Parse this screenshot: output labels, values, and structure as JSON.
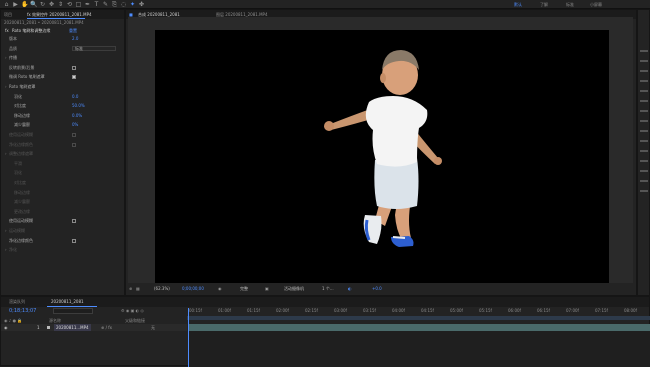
{
  "toolbar": {
    "tools": [
      "home-icon",
      "selection-icon",
      "hand-icon",
      "zoom-icon",
      "orbit-icon",
      "pan-icon",
      "dolly-icon",
      "rotate-icon",
      "rect-mask-icon",
      "pen-icon",
      "type-icon",
      "brush-icon",
      "clone-icon",
      "eraser-icon",
      "roto-brush-icon",
      "puppet-icon"
    ],
    "workspaces": [
      "默认",
      "了解",
      "标准",
      "小屏幕"
    ]
  },
  "project_tab": "项目",
  "effect_tab": "fx 效果控件 20200811_2081.MP4",
  "effect_subtitle": "20200811_2081 • 20200811_2081.MP4",
  "comp_tabs": {
    "comp": "合成 20200811_2081",
    "footage": "图层 20200811_2081.MP4"
  },
  "comp_subtab": "20200811_2081",
  "effect": {
    "name": "Roto 笔刷和调整边缘",
    "reset": "重置",
    "props": [
      {
        "label": "版本",
        "value": "2.0",
        "style": "blue"
      },
      {
        "label": "品质",
        "value": "标准",
        "type": "dropdown"
      },
      {
        "label": "传播",
        "value": "",
        "type": "section"
      },
      {
        "label": "反转前景/后景",
        "type": "checkbox",
        "checked": false
      },
      {
        "label": "微调 Roto 笔刷遮罩",
        "type": "checkbox",
        "checked": true
      },
      {
        "label": "Roto 笔刷遮罩",
        "value": "",
        "type": "section"
      },
      {
        "label": "羽化",
        "value": "0.0",
        "style": "blue",
        "indent": 2
      },
      {
        "label": "对比度",
        "value": "50.0%",
        "style": "blue",
        "indent": 2
      },
      {
        "label": "移动边缘",
        "value": "0.0%",
        "style": "blue",
        "indent": 2
      },
      {
        "label": "减少震颤",
        "value": "0%",
        "style": "blue",
        "indent": 2
      },
      {
        "label": "使用运动模糊",
        "type": "checkbox",
        "dim": true
      },
      {
        "label": "净化边缘颜色",
        "type": "checkbox",
        "dim": true
      },
      {
        "label": "调整边缘遮罩",
        "type": "section",
        "dim": true
      },
      {
        "label": "平滑",
        "value": "",
        "dim": true,
        "indent": 2
      },
      {
        "label": "羽化",
        "value": "",
        "dim": true,
        "indent": 2
      },
      {
        "label": "对比度",
        "value": "",
        "dim": true,
        "indent": 2
      },
      {
        "label": "移动边缘",
        "value": "",
        "dim": true,
        "indent": 2
      },
      {
        "label": "减少震颤",
        "value": "",
        "dim": true,
        "indent": 2
      },
      {
        "label": "更改边缘",
        "value": "",
        "dim": true,
        "indent": 2
      },
      {
        "label": "使用运动模糊",
        "type": "checkbox",
        "checked": false
      },
      {
        "label": "运动模糊",
        "type": "section",
        "dim": true
      },
      {
        "label": "净化边缘颜色",
        "type": "checkbox",
        "checked": false
      },
      {
        "label": "净化",
        "type": "section",
        "dim": true
      }
    ]
  },
  "viewer": {
    "zoom": "(62.3%)",
    "timecode": "0;00;00;00",
    "resolution": "完整",
    "camera": "活动摄像机",
    "views": "1 个...",
    "offset": "+0.0"
  },
  "right_panel_labels": [
    "",
    "",
    "",
    "",
    "",
    "",
    "",
    "",
    "",
    "",
    "",
    "",
    "",
    "",
    ""
  ],
  "timeline": {
    "render_queue_tab": "渲染队列",
    "comp_tab": "20200811_2081",
    "timecode": "0;18;13;07",
    "search_placeholder": "",
    "col_source": "源名称",
    "col_parent": "父级和链接",
    "layer_number": "1",
    "layer_name": "20200811...MP4",
    "layer_parent": "无",
    "ruler": [
      "00:15f",
      "01:00f",
      "01:15f",
      "02:00f",
      "02:15f",
      "03:00f",
      "03:15f",
      "04:00f",
      "04:15f",
      "05:00f",
      "05:15f",
      "06:00f",
      "06:15f",
      "07:00f",
      "07:15f",
      "08:00f"
    ]
  }
}
